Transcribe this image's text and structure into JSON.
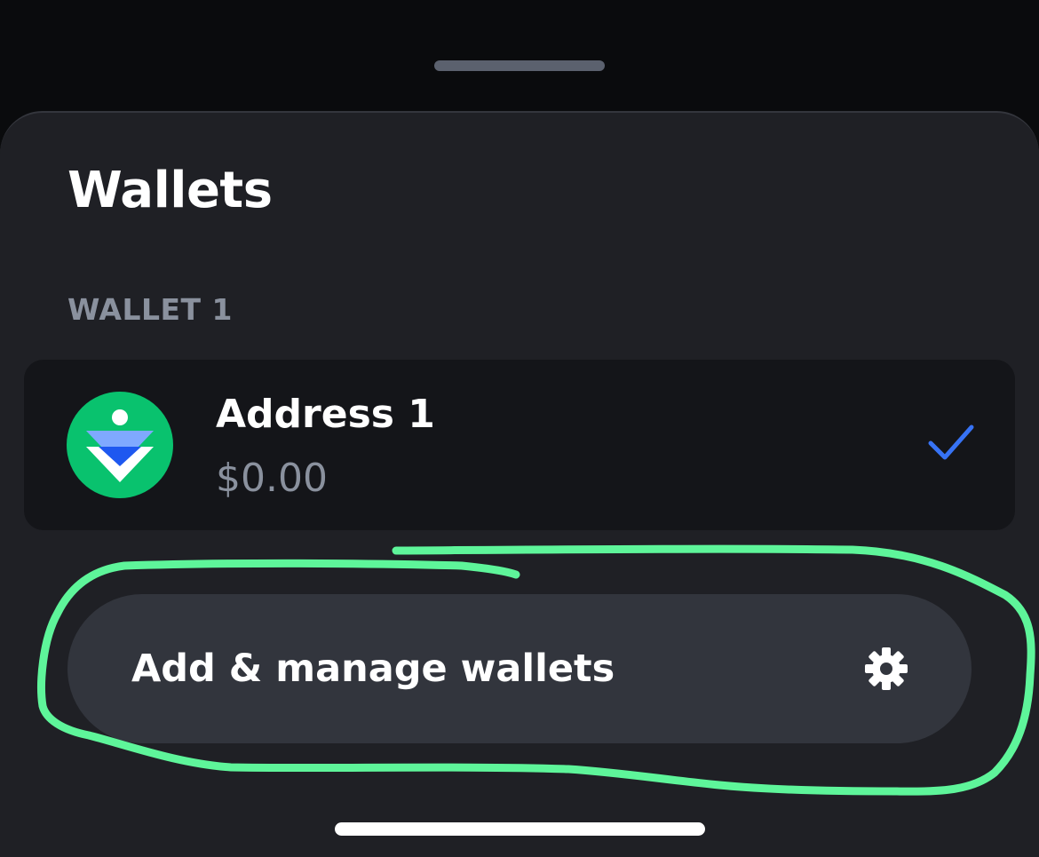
{
  "sheet": {
    "title": "Wallets",
    "section_label": "WALLET 1"
  },
  "wallet": {
    "name": "Address 1",
    "balance": "$0.00",
    "selected": true,
    "avatar_icon": "wallet-avatar-icon",
    "check_icon": "checkmark-icon"
  },
  "manage": {
    "label": "Add & manage wallets",
    "icon": "gear-icon"
  },
  "colors": {
    "background": "#0a0b0d",
    "sheet": "#1f2025",
    "row": "#141519",
    "button": "#32353d",
    "muted_text": "#8a919e",
    "accent_blue": "#3773f5",
    "avatar_green": "#09c26e",
    "annotation_green": "#5ef59a"
  }
}
